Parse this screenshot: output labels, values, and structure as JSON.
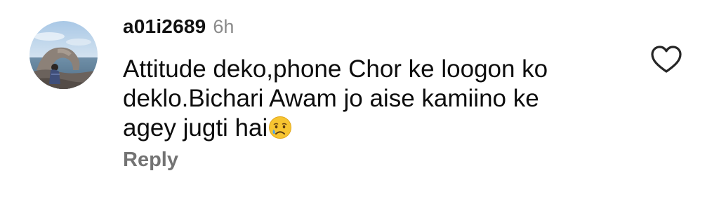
{
  "comment": {
    "username": "a01i2689",
    "time": "6h",
    "text_line1": "Attitude deko,phone Chor ke loogon ko",
    "text_line2": "deklo.Bichari Awam jo aise kamiino ke",
    "text_line3": "agey jugti hai",
    "emoji": "crying-face-emoji",
    "reply_label": "Reply",
    "like_icon": "heart-outline-icon",
    "avatar": "profile-photo-coastal-rocks"
  },
  "colors": {
    "username": "#111111",
    "time": "#8a8a8a",
    "reply": "#737373",
    "heart_outline": "#262626"
  }
}
